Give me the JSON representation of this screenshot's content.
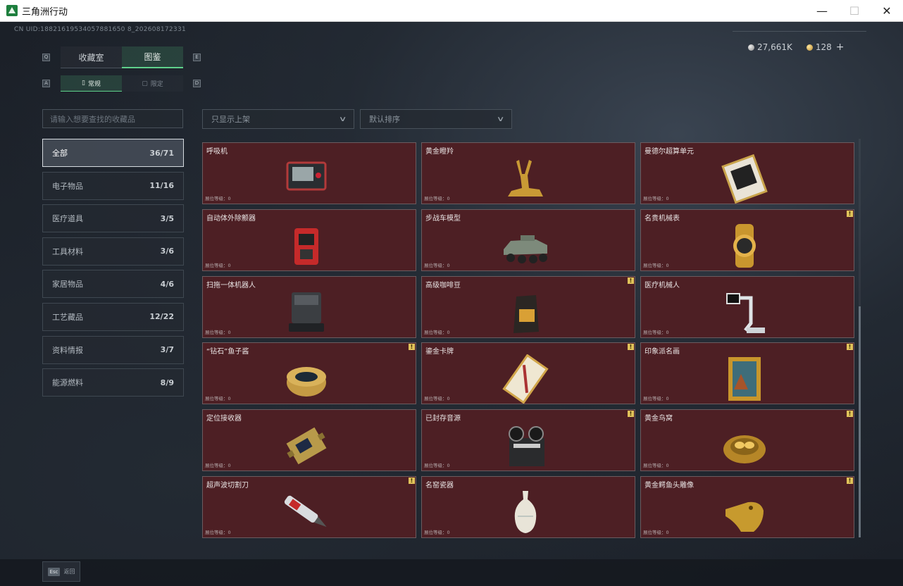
{
  "window": {
    "title": "三角洲行动",
    "minimize": "—",
    "maximize": "☐",
    "close": "✕"
  },
  "header": {
    "uid": "CN UID:18821619534057881650 8_202608172331",
    "silver_amount": "27,661K",
    "gold_amount": "128",
    "plus": "+"
  },
  "key_hints": {
    "q": "Q",
    "e": "E",
    "a": "A",
    "d": "D"
  },
  "tabs": [
    {
      "label": "收藏室"
    },
    {
      "label": "图鉴"
    }
  ],
  "subtabs": [
    {
      "label": "常规",
      "icon": "▯"
    },
    {
      "label": "限定",
      "icon": "▢"
    }
  ],
  "search": {
    "placeholder": "请输入想要查找的收藏品"
  },
  "filters": {
    "shelf": "只显示上架",
    "sort": "默认排序"
  },
  "categories": [
    {
      "label": "全部",
      "count": "36/71"
    },
    {
      "label": "电子物品",
      "count": "11/16"
    },
    {
      "label": "医疗道具",
      "count": "3/5"
    },
    {
      "label": "工具材料",
      "count": "3/6"
    },
    {
      "label": "家居物品",
      "count": "4/6"
    },
    {
      "label": "工艺藏品",
      "count": "12/22"
    },
    {
      "label": "资料情报",
      "count": "3/7"
    },
    {
      "label": "能源燃料",
      "count": "8/9"
    }
  ],
  "items": [
    {
      "name": "呼吸机",
      "level": "展位等级：0",
      "icon": "ventilator-icon",
      "warn": ""
    },
    {
      "name": "黄金瞪羚",
      "level": "展位等级：0",
      "icon": "gold-gazelle-icon",
      "warn": ""
    },
    {
      "name": "曼德尔超算单元",
      "level": "展位等级：0",
      "icon": "supercompute-unit-icon",
      "warn": ""
    },
    {
      "name": "自动体外除颤器",
      "level": "展位等级：0",
      "icon": "defibrillator-icon",
      "warn": ""
    },
    {
      "name": "步战车模型",
      "level": "展位等级：0",
      "icon": "ifv-model-icon",
      "warn": ""
    },
    {
      "name": "名贵机械表",
      "level": "展位等级：0",
      "icon": "watch-icon",
      "warn": "!"
    },
    {
      "name": "扫拖一体机器人",
      "level": "展位等级：0",
      "icon": "robot-vacuum-icon",
      "warn": ""
    },
    {
      "name": "高级咖啡豆",
      "level": "展位等级：0",
      "icon": "coffee-bag-icon",
      "warn": "!"
    },
    {
      "name": "医疗机械人",
      "level": "展位等级：0",
      "icon": "medical-robot-icon",
      "warn": ""
    },
    {
      "name": "“钻石”鱼子酱",
      "level": "展位等级：0",
      "icon": "caviar-tin-icon",
      "warn": "!"
    },
    {
      "name": "鎏金卡牌",
      "level": "展位等级：0",
      "icon": "gilded-card-icon",
      "warn": "!"
    },
    {
      "name": "印象派名画",
      "level": "展位等级：0",
      "icon": "painting-icon",
      "warn": "!"
    },
    {
      "name": "定位接收器",
      "level": "展位等级：0",
      "icon": "gps-receiver-icon",
      "warn": ""
    },
    {
      "name": "已封存音源",
      "level": "展位等级：0",
      "icon": "reel-recorder-icon",
      "warn": "!"
    },
    {
      "name": "黄金鸟窝",
      "level": "展位等级：0",
      "icon": "gold-nest-icon",
      "warn": "!"
    },
    {
      "name": "超声波切割刀",
      "level": "展位等级：0",
      "icon": "ultrasonic-cutter-icon",
      "warn": "!"
    },
    {
      "name": "名窑瓷器",
      "level": "展位等级：0",
      "icon": "porcelain-vase-icon",
      "warn": ""
    },
    {
      "name": "黄金鳄鱼头雕像",
      "level": "展位等级：0",
      "icon": "gold-croc-head-icon",
      "warn": "!"
    }
  ],
  "footer": {
    "esc_key": "Esc",
    "back_label": "返回"
  },
  "colors": {
    "card_bg": "#4d1f24",
    "accent_green": "#5fd18b",
    "warn_yellow": "#e0c25a"
  }
}
